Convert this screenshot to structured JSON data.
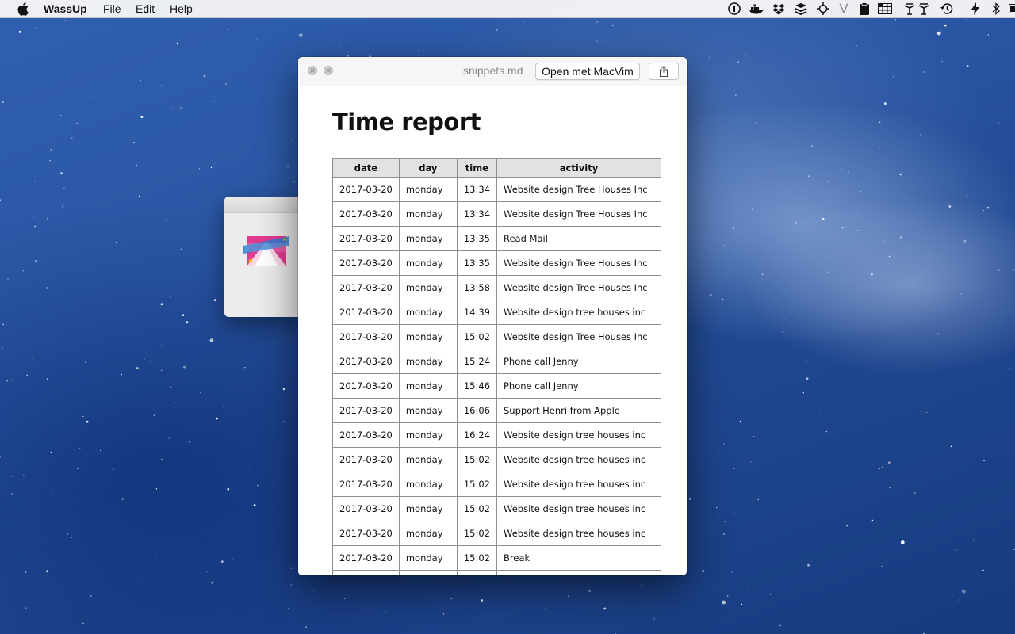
{
  "menubar": {
    "app_name": "WassUp",
    "menus": [
      "File",
      "Edit",
      "Help"
    ],
    "status_icons": [
      "onepassword-icon",
      "docker-icon",
      "dropbox-icon",
      "buffer-icon",
      "move-icon",
      "vim-icon",
      "clipboard-icon",
      "grid-icon",
      "bartender-icon",
      "time-machine-icon",
      "lightning-icon",
      "bluetooth-icon",
      "battery-icon"
    ]
  },
  "back_window": {
    "logo": "wassup-logo"
  },
  "window": {
    "title": "snippets.md",
    "open_button": "Open met MacVim",
    "share_icon": "share-icon"
  },
  "document": {
    "heading": "Time report",
    "table": {
      "headers": [
        "date",
        "day",
        "time",
        "activity"
      ],
      "rows": [
        [
          "2017-03-20",
          "monday",
          "13:34",
          "Website design Tree Houses Inc"
        ],
        [
          "2017-03-20",
          "monday",
          "13:34",
          "Website design Tree Houses Inc"
        ],
        [
          "2017-03-20",
          "monday",
          "13:35",
          "Read Mail"
        ],
        [
          "2017-03-20",
          "monday",
          "13:35",
          "Website design Tree Houses Inc"
        ],
        [
          "2017-03-20",
          "monday",
          "13:58",
          "Website design Tree Houses Inc"
        ],
        [
          "2017-03-20",
          "monday",
          "14:39",
          "Website design tree houses inc"
        ],
        [
          "2017-03-20",
          "monday",
          "15:02",
          "Website design Tree Houses Inc"
        ],
        [
          "2017-03-20",
          "monday",
          "15:24",
          "Phone call Jenny"
        ],
        [
          "2017-03-20",
          "monday",
          "15:46",
          "Phone call Jenny"
        ],
        [
          "2017-03-20",
          "monday",
          "16:06",
          "Support Henri from Apple"
        ],
        [
          "2017-03-20",
          "monday",
          "16:24",
          "Website design tree houses inc"
        ],
        [
          "2017-03-20",
          "monday",
          "15:02",
          "Website design tree houses inc"
        ],
        [
          "2017-03-20",
          "monday",
          "15:02",
          "Website design tree houses inc"
        ],
        [
          "2017-03-20",
          "monday",
          "15:02",
          "Website design tree houses inc"
        ],
        [
          "2017-03-20",
          "monday",
          "15:02",
          "Website design tree houses inc"
        ],
        [
          "2017-03-20",
          "monday",
          "15:02",
          "Break"
        ],
        [
          "",
          "",
          "",
          ""
        ]
      ]
    }
  }
}
